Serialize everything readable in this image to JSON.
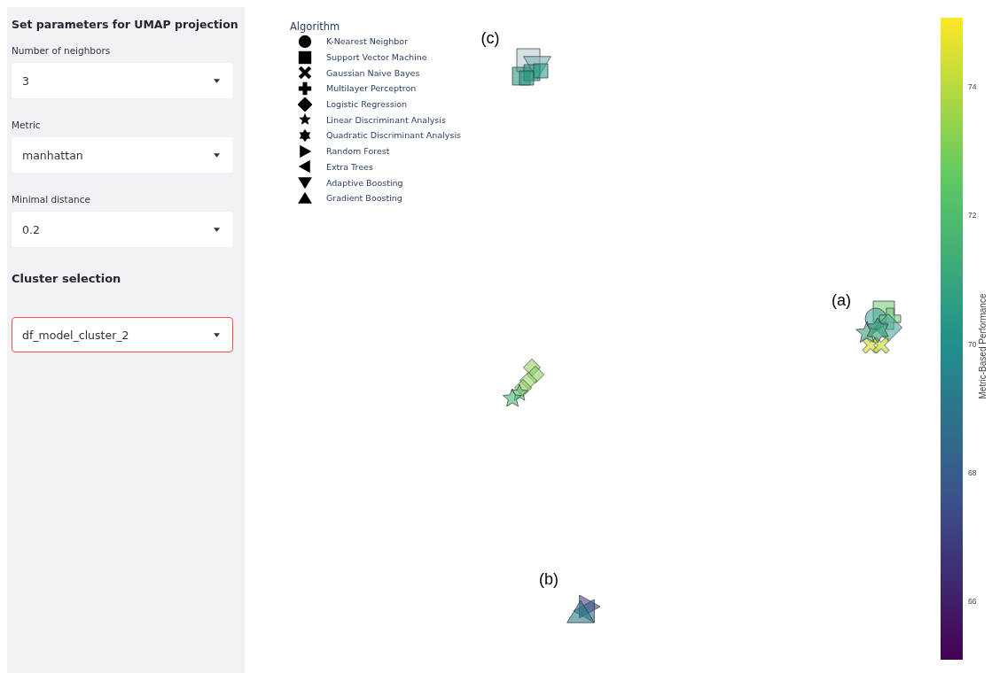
{
  "sidebar": {
    "title": "Set parameters for UMAP projection",
    "fields": [
      {
        "label": "Number of neighbors",
        "value": "3"
      },
      {
        "label": "Metric",
        "value": "manhattan"
      },
      {
        "label": "Minimal distance",
        "value": "0.2"
      }
    ],
    "cluster_heading": "Cluster selection",
    "cluster_select": {
      "value": "df_model_cluster_2",
      "focused": true
    }
  },
  "plot": {
    "legend": {
      "title": "Algorithm",
      "items": [
        {
          "label": "K-Nearest Neighbor",
          "kind": "circle"
        },
        {
          "label": "Support Vector Machine",
          "kind": "square"
        },
        {
          "label": "Gaussian Naive Bayes",
          "kind": "x"
        },
        {
          "label": "Multilayer Perceptron",
          "kind": "cross"
        },
        {
          "label": "Logistic Regression",
          "kind": "diamond"
        },
        {
          "label": "Linear Discriminant Analysis",
          "kind": "star"
        },
        {
          "label": "Quadratic Discriminant Analysis",
          "kind": "hexagram"
        },
        {
          "label": "Random Forest",
          "kind": "triangle-right"
        },
        {
          "label": "Extra Trees",
          "kind": "triangle-left"
        },
        {
          "label": "Adaptive Boosting",
          "kind": "triangle-down"
        },
        {
          "label": "Gradient Boosting",
          "kind": "triangle-up"
        }
      ]
    },
    "annotations": [
      "(c)",
      "(a)",
      "(b)"
    ],
    "colorbar": {
      "title": "Metric-Based Performance",
      "ticks": [
        "74",
        "72",
        "70",
        "68",
        "66"
      ]
    }
  }
}
